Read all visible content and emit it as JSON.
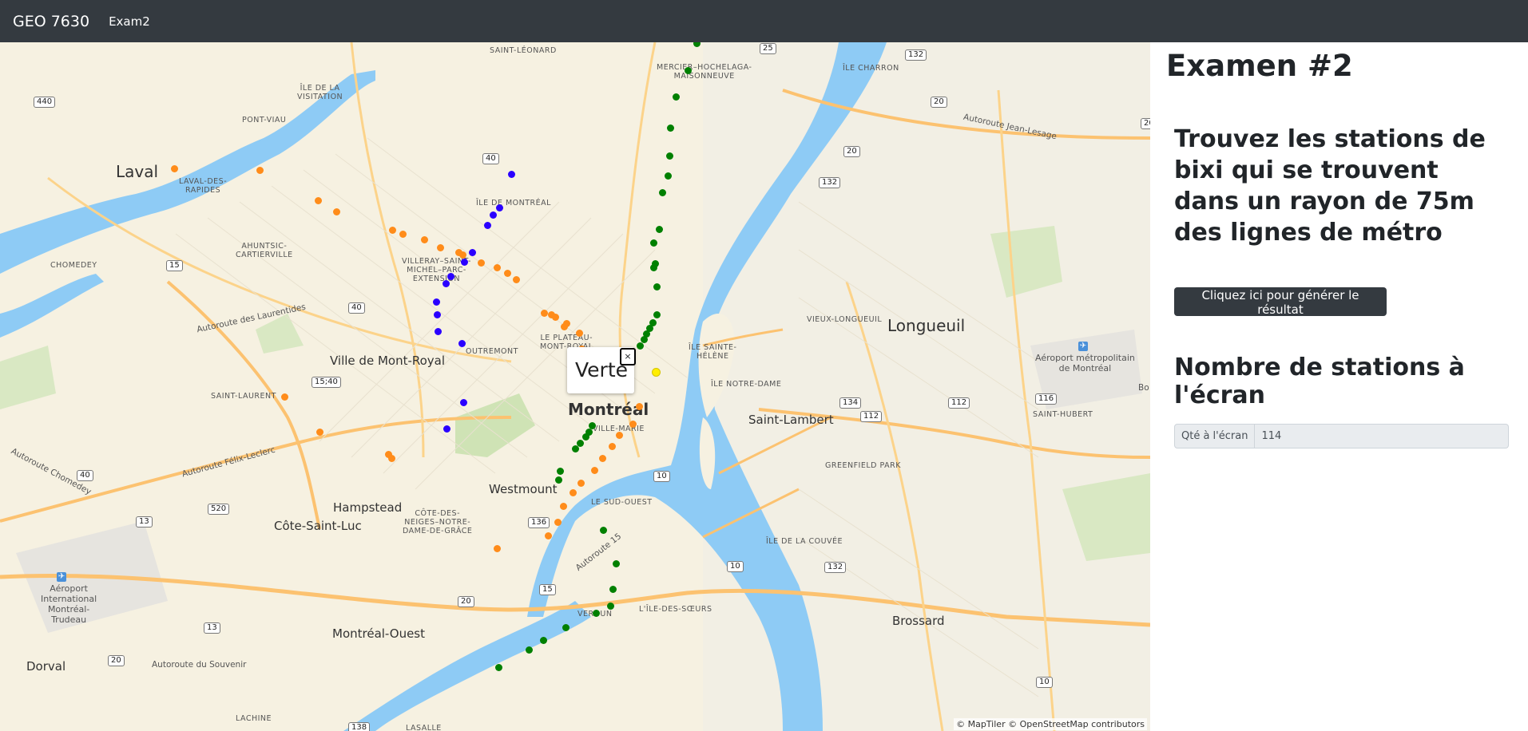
{
  "navbar": {
    "brand": "GEO 7630",
    "link": "Exam2"
  },
  "map": {
    "labels": {
      "laval": "Laval",
      "longueuil": "Longueuil",
      "montreal": "Montréal",
      "ville_mont_royal": "Ville de Mont-Royal",
      "westmount": "Westmount",
      "hampstead": "Hampstead",
      "cote_saint_luc": "Côte-Saint-Luc",
      "montreal_ouest": "Montréal-Ouest",
      "dorval": "Dorval",
      "saint_lambert": "Saint-Lambert",
      "brossard": "Brossard",
      "saint_leonard": "SAINT-LÉONARD",
      "mercier": "MERCIER–HOCHELAGA-\nMAISONNEUVE",
      "ile_charron": "ÎLE CHARRON",
      "ile_visitation": "ÎLE DE LA\nVISITATION",
      "pont_viau": "PONT-VIAU",
      "laval_des_rapides": "LAVAL-DES-\nRAPIDES",
      "ile_de_montreal": "ÎLE DE MONTRÉAL",
      "ahuntsic": "AHUNTSIC-\nCARTIERVILLE",
      "chomedey": "CHOMEDEY",
      "villeray": "VILLERAY–SAINT-\nMICHEL–PARC-\nEXTENSION",
      "plateau": "LE PLATEAU-\nMONT-ROYAL",
      "outremont": "OUTREMONT",
      "saint_laurent": "SAINT-LAURENT",
      "ile_sainte_helene": "ÎLE SAINTE-\nHÉLÈNE",
      "ile_notre_dame": "ÎLE NOTRE-DAME",
      "vieux_longueuil": "VIEUX-LONGUEUIL",
      "saint_hubert": "SAINT-HUBERT",
      "greenfield_park": "GREENFIELD PARK",
      "ile_couvee": "ÎLE DE LA COUVÉE",
      "ville_marie": "VILLE-MARIE",
      "sud_ouest": "LE SUD-OUEST",
      "cdn": "CÔTE-DES-\nNEIGES–NOTRE-\nDAME-DE-GRÂCE",
      "verdun": "VERDUN",
      "ile_soeurs": "L'ÎLE-DES-SŒURS",
      "lachine": "LACHINE",
      "lasalle": "LASALLE",
      "aeroport_montreal": "Aéroport\nInternational\nMontréal-\nTrudeau",
      "aeroport_longueuil": "Aéroport métropolitain\nde Montréal",
      "autoroute_laurentides": "Autoroute des Laurentides",
      "autoroute_chomedey": "Autoroute Chomedey",
      "autoroute_felix": "Autoroute Félix-Leclerc",
      "autoroute_jean_lesage": "Autoroute Jean-Lesage",
      "autoroute_15": "Autoroute 15",
      "autoroute_souvenir": "Autoroute du Souvenir",
      "bo": "Bo"
    },
    "shields": [
      "25",
      "132",
      "20",
      "440",
      "40",
      "15",
      "15;40",
      "13",
      "520",
      "136",
      "10",
      "15",
      "20",
      "138",
      "134",
      "112",
      "116",
      "112",
      "10",
      "132",
      "20",
      "20",
      "13",
      "10",
      "20",
      "40",
      "132",
      "40"
    ],
    "popup": {
      "text": "Verte",
      "close": "×"
    },
    "attribution": "© MapTiler © OpenStreetMap contributors",
    "colors": {
      "verte": "#008000",
      "orange": "#ff8c1a",
      "bleue": "#2a00ff",
      "jaune": "#ffee00",
      "water": "#8ecbf5",
      "land": "#f6f1e1",
      "road_major": "#fcd38a"
    }
  },
  "panel": {
    "title": "Examen #2",
    "question": "Trouvez les stations de bixi qui se trouvent dans un rayon de 75m des lignes de métro",
    "button": "Cliquez ici pour générer le résultat",
    "count_heading": "Nombre de stations à l'écran",
    "count_label": "Qté à l'écran",
    "count_value": "114"
  }
}
